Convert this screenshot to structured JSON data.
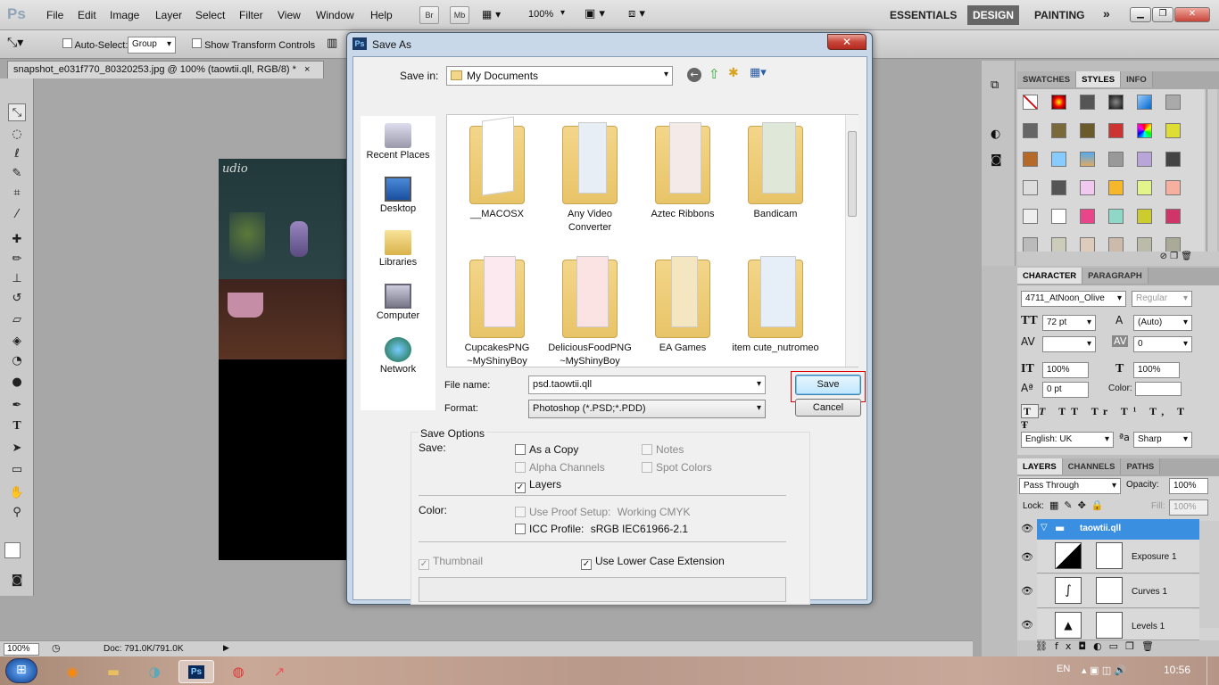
{
  "app": {
    "logo": "Ps"
  },
  "menu": [
    "File",
    "Edit",
    "Image",
    "Layer",
    "Select",
    "Filter",
    "View",
    "Window",
    "Help"
  ],
  "menubar": {
    "br": "Br",
    "mb": "Mb",
    "zoom": "100%",
    "workspaces": [
      "ESSENTIALS",
      "DESIGN",
      "PAINTING"
    ],
    "more": "»"
  },
  "options": {
    "auto_select_label": "Auto-Select:",
    "auto_select_value": "Group",
    "transform_label": "Show Transform Controls"
  },
  "document": {
    "tab_title": "snapshot_e031f770_80320253.jpg @ 100% (taowtii.qll, RGB/8) *",
    "close": "×",
    "canvas_text": "udio"
  },
  "status": {
    "zoom": "100%",
    "doc": "Doc: 791.0K/791.0K"
  },
  "dialog": {
    "title": "Save As",
    "close": "✕",
    "save_in_label": "Save in:",
    "save_in_value": "My Documents",
    "places": [
      "Recent Places",
      "Desktop",
      "Libraries",
      "Computer",
      "Network"
    ],
    "folders": [
      {
        "name": "__MACOSX",
        "color": "#f3d68a"
      },
      {
        "name": "Any Video Converter",
        "color": "#f3d68a"
      },
      {
        "name": "Aztec Ribbons",
        "color": "#f3d68a"
      },
      {
        "name": "Bandicam",
        "color": "#f3d68a"
      },
      {
        "name": "CupcakesPNG ~MyShinyBoy",
        "color": "#f3d68a"
      },
      {
        "name": "DeliciousFoodPNG ~MyShinyBoy",
        "color": "#f3d68a"
      },
      {
        "name": "EA Games",
        "color": "#f3d68a"
      },
      {
        "name": "item cute_nutromeo",
        "color": "#f3d68a"
      }
    ],
    "file_name_label": "File name:",
    "file_name_value": "psd.taowtii.qll",
    "format_label": "Format:",
    "format_value": "Photoshop (*.PSD;*.PDD)",
    "save_button": "Save",
    "cancel_button": "Cancel",
    "save_options_title": "Save Options",
    "save_label": "Save:",
    "as_a_copy": "As a Copy",
    "notes": "Notes",
    "alpha_channels": "Alpha Channels",
    "spot_colors": "Spot Colors",
    "layers": "Layers",
    "color_label": "Color:",
    "use_proof_setup": "Use Proof Setup:",
    "working_cmyk": "Working CMYK",
    "icc_profile": "ICC Profile:",
    "icc_value": "sRGB IEC61966-2.1",
    "thumbnail": "Thumbnail",
    "lower_case": "Use Lower Case Extension"
  },
  "panels": {
    "swatch_tabs": [
      "SWATCHES",
      "STYLES",
      "INFO"
    ],
    "char_tabs": [
      "CHARACTER",
      "PARAGRAPH"
    ],
    "font_family": "4711_AtNoon_Olive",
    "font_style": "Regular",
    "font_size": "72 pt",
    "leading": "(Auto)",
    "tracking": "0",
    "vscale": "100%",
    "hscale": "100%",
    "baseline": "0 pt",
    "color_label": "Color:",
    "language": "English: UK",
    "aa": "Sharp",
    "aa_icon": "ªa",
    "layer_tabs": [
      "LAYERS",
      "CHANNELS",
      "PATHS"
    ],
    "blend": "Pass Through",
    "opacity_label": "Opacity:",
    "opacity": "100%",
    "lock_label": "Lock:",
    "fill_label": "Fill:",
    "fill": "100%",
    "layers": [
      "taowtii.qll",
      "Exposure 1",
      "Curves 1",
      "Levels 1"
    ]
  },
  "taskbar": {
    "lang": "EN",
    "time": "10:56"
  }
}
